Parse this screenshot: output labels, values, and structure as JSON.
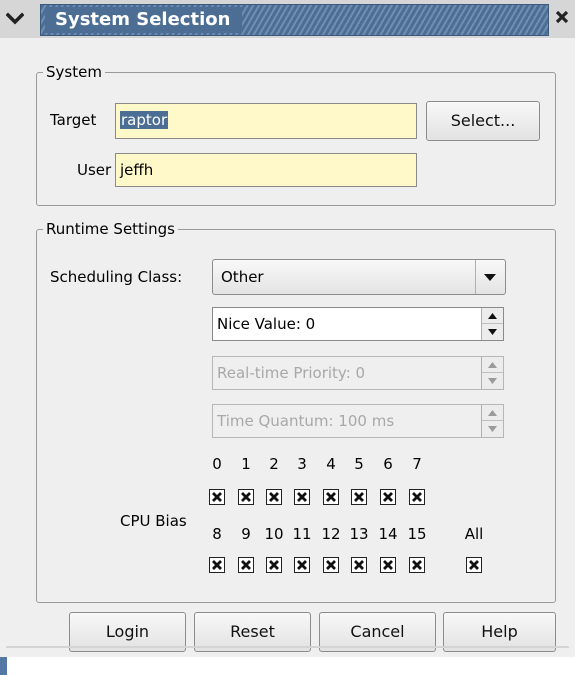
{
  "window": {
    "title": "System Selection"
  },
  "system": {
    "legend": "System",
    "target_label": "Target",
    "target_value": "raptor",
    "select_button": "Select...",
    "user_label": "User",
    "user_value": "jeffh"
  },
  "runtime": {
    "legend": "Runtime Settings",
    "scheduling_label": "Scheduling Class:",
    "scheduling_value": "Other",
    "nice_value": "Nice Value: 0",
    "realtime_priority": "Real-time Priority: 0",
    "time_quantum": "Time Quantum: 100 ms",
    "cpu_bias_label": "CPU Bias",
    "cpu_row1": [
      "0",
      "1",
      "2",
      "3",
      "4",
      "5",
      "6",
      "7"
    ],
    "cpu_row2": [
      "8",
      "9",
      "10",
      "11",
      "12",
      "13",
      "14",
      "15"
    ],
    "cpu_all_label": "All",
    "cpu_row1_checked": [
      true,
      true,
      true,
      true,
      true,
      true,
      true,
      true
    ],
    "cpu_row2_checked": [
      true,
      true,
      true,
      true,
      true,
      true,
      true,
      true
    ],
    "cpu_all_checked": true
  },
  "buttons": {
    "login": "Login",
    "reset": "Reset",
    "cancel": "Cancel",
    "help": "Help"
  },
  "colors": {
    "titlebar": "#4d6e94",
    "entry_bg": "#fff8c8",
    "selection": "#4d6e94"
  }
}
